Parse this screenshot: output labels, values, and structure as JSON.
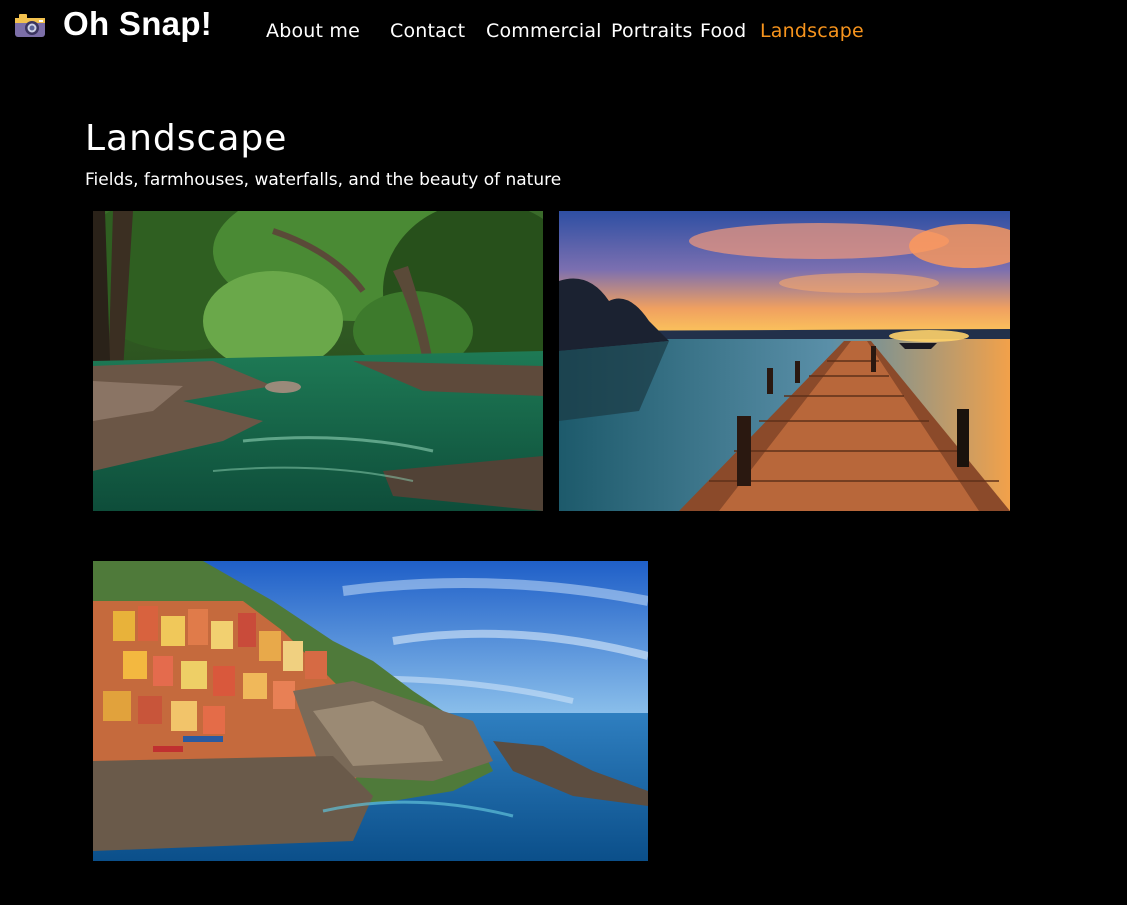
{
  "header": {
    "logo_icon": "camera-icon",
    "brand": "Oh Snap!"
  },
  "nav": {
    "items": [
      {
        "label": "About me",
        "active": false
      },
      {
        "label": "Contact",
        "active": false
      },
      {
        "label": "Commercial",
        "active": false
      },
      {
        "label": "Portraits",
        "active": false
      },
      {
        "label": "Food",
        "active": false
      },
      {
        "label": "Landscape",
        "active": true
      }
    ],
    "active_color": "#f7941d"
  },
  "page": {
    "title": "Landscape",
    "subtitle": "Fields, farmhouses, waterfalls, and the beauty of nature"
  },
  "gallery": {
    "photos": [
      {
        "name": "river-forest-photo"
      },
      {
        "name": "lake-pier-sunset-photo"
      },
      {
        "name": "coastal-village-photo"
      }
    ]
  }
}
